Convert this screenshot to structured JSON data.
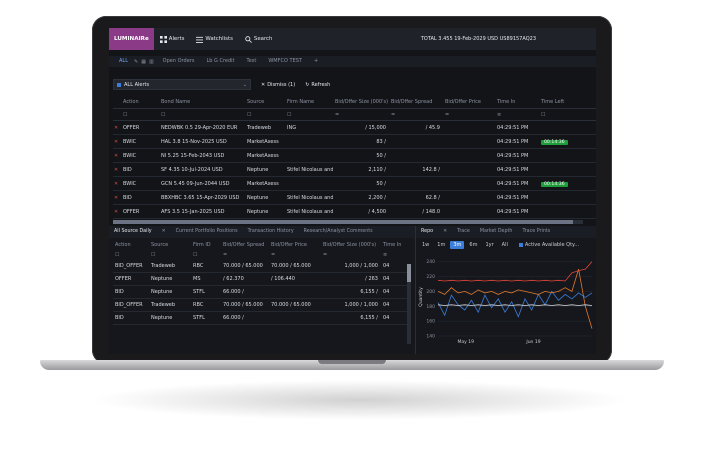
{
  "topbar": {
    "logo": "LUMINAIRe",
    "nav": [
      {
        "label": "Alerts",
        "icon": "grid-icon"
      },
      {
        "label": "Watchlists",
        "icon": "list-icon"
      },
      {
        "label": "Search",
        "icon": "search-icon"
      }
    ],
    "status": "TOTAL 3.455 19-Feb-2029 USD US89157AQ23"
  },
  "tabs": [
    "ALL",
    "Open Orders",
    "Lb G Credit",
    "Test",
    "WMFCO TEST"
  ],
  "filterbar": {
    "selected": "ALL Alerts",
    "dismiss": "Dismiss (1)",
    "refresh": "Refresh"
  },
  "main_grid": {
    "columns": [
      "Action",
      "Bond Name",
      "Source",
      "Firm Name",
      "Bid/Offer Size (000's)",
      "Bid/Offer Spread",
      "Bid/Offer Price",
      "Time In",
      "Time Left"
    ],
    "rows": [
      {
        "action": "OFFER",
        "bond": "NEDWBK 0.5 29-Apr-2020 EUR",
        "source": "Tradeweb",
        "firm": "ING",
        "size": "/  15,000",
        "spread": "/  45.9",
        "price": "",
        "time_in": "04:29:51 PM",
        "time_left": ""
      },
      {
        "action": "BWIC",
        "bond": "HAL 3.8 15-Nov-2025 USD",
        "source": "MarketAxess",
        "firm": "",
        "size": "83 /",
        "spread": "",
        "price": "",
        "time_in": "04:29:51 PM",
        "time_left": "00:14:36"
      },
      {
        "action": "BWIC",
        "bond": "NI 5.25 15-Feb-2043 USD",
        "source": "MarketAxess",
        "firm": "",
        "size": "50 /",
        "spread": "",
        "price": "",
        "time_in": "04:29:51 PM",
        "time_left": ""
      },
      {
        "action": "BID",
        "bond": "SF 4.35 10-Jul-2024 USD",
        "source": "Neptune",
        "firm": "Stifel Nicolaus and",
        "size": "2,110 /",
        "spread": "142.8 /",
        "price": "",
        "time_in": "04:29:51 PM",
        "time_left": ""
      },
      {
        "action": "BWIC",
        "bond": "GCN 5.45 09-Jun-2044 USD",
        "source": "MarketAxess",
        "firm": "",
        "size": "50 /",
        "spread": "",
        "price": "",
        "time_in": "04:29:51 PM",
        "time_left": "00:14:36"
      },
      {
        "action": "BID",
        "bond": "BBXHBC 3.65 15-Apr-2029 USD",
        "source": "Neptune",
        "firm": "Stifel Nicolaus and",
        "size": "2,200 /",
        "spread": "62.8 /",
        "price": "",
        "time_in": "04:29:51 PM",
        "time_left": ""
      },
      {
        "action": "OFFER",
        "bond": "AFS 3.5 15-Jan-2025 USD",
        "source": "Neptune",
        "firm": "Stifel Nicolaus and",
        "size": "/  4,500",
        "spread": "/  148.0",
        "price": "",
        "time_in": "04:29:51 PM",
        "time_left": ""
      }
    ]
  },
  "lower_tabs": [
    "All Source Daily",
    "Current Portfolio Positions",
    "Transaction History",
    "Research/Analyst Comments"
  ],
  "lower_grid": {
    "columns": [
      "Action",
      "Source",
      "Firm ID",
      "Bid/Offer Spread",
      "Bid/Offer Price",
      "Bid/Offer Size (000's)",
      "Time In"
    ],
    "rows": [
      {
        "action": "BID_OFFER",
        "source": "Tradeweb",
        "firm": "RBC",
        "spread": "70.000 / 65.000",
        "price": "70.000 /  65.000",
        "size": "1,000 /  1,000",
        "time": "04"
      },
      {
        "action": "OFFER",
        "source": "Neptune",
        "firm": "MS",
        "spread": "/  62.370",
        "price": "/ 106.440",
        "size": "/  263",
        "time": "04"
      },
      {
        "action": "BID",
        "source": "Neptune",
        "firm": "STFL",
        "spread": "66.000 /",
        "price": "",
        "size": "6,155 /",
        "time": "04"
      },
      {
        "action": "BID_OFFER",
        "source": "Tradeweb",
        "firm": "RBC",
        "spread": "70.000 / 65.000",
        "price": "70.000 /  65.000",
        "size": "1,000 /  1,000",
        "time": "04"
      },
      {
        "action": "BID",
        "source": "Neptune",
        "firm": "STFL",
        "spread": "66.000 /",
        "price": "",
        "size": "6,155 /",
        "time": "04"
      }
    ]
  },
  "chart_tabs": [
    "Repo",
    "Trace",
    "Market Depth",
    "Trace Prints"
  ],
  "chart_ranges": [
    "1w",
    "1m",
    "3m",
    "6m",
    "1yr",
    "All"
  ],
  "chart_ranges_selected": "3m",
  "chart_qty": "Active Available Qty...",
  "colors": {
    "accent": "#3b7dd8",
    "brand": "#8a3a86",
    "series_a": "#3b7dd8",
    "series_b": "#e07a2e",
    "series_c": "#e0463a",
    "series_d": "#d8dbe2"
  },
  "chart_data": {
    "type": "line",
    "ylabel": "Quantity",
    "ylim": [
      140,
      245
    ],
    "yticks": [
      140,
      160,
      180,
      200,
      220,
      240
    ],
    "xticks": [
      {
        "label": "May 19",
        "x": 0.18
      },
      {
        "label": "Jun 19",
        "x": 0.62
      }
    ],
    "series": [
      {
        "color": "#3b7dd8",
        "values": [
          185,
          168,
          195,
          182,
          175,
          188,
          172,
          195,
          178,
          190,
          172,
          186,
          166,
          190,
          175,
          196,
          182,
          200,
          188,
          196,
          190,
          198,
          192,
          198
        ]
      },
      {
        "color": "#e07a2e",
        "values": [
          200,
          196,
          205,
          198,
          200,
          196,
          202,
          198,
          200,
          196,
          200,
          198,
          202,
          200,
          198,
          196,
          200,
          198,
          200,
          205,
          200,
          230,
          180,
          150
        ]
      },
      {
        "color": "#e0463a",
        "values": [
          215,
          214,
          215,
          214,
          215,
          214,
          215,
          214,
          215,
          214,
          215,
          214,
          215,
          214,
          215,
          214,
          215,
          214,
          215,
          214,
          225,
          228,
          230,
          240
        ]
      },
      {
        "color": "#d8dbe2",
        "values": [
          182,
          181,
          182,
          181,
          182,
          181,
          182,
          181,
          182,
          181,
          182,
          181,
          182,
          181,
          182,
          181,
          182,
          181,
          182,
          181,
          182,
          181,
          182,
          181
        ]
      }
    ]
  }
}
